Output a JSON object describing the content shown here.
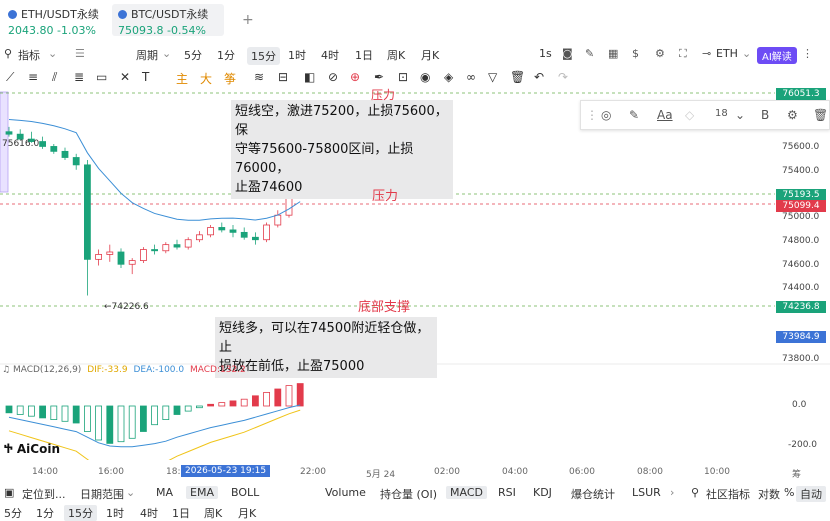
{
  "tabs": [
    {
      "symbol": "ETH/USDT永续",
      "price": "2043.80",
      "change": "-1.03%"
    },
    {
      "symbol": "BTC/USDT永续",
      "price": "75093.8",
      "change": "-0.54%"
    }
  ],
  "add_tab": "+",
  "toolbar": {
    "indicators": "指标",
    "period": "周期",
    "periods": [
      "5分",
      "1分",
      "15分",
      "1时",
      "4时",
      "1日",
      "周K",
      "月K"
    ],
    "selected_period": "15分",
    "right_label": "1s",
    "eth_label": "ETH",
    "ai_label": "AI解读"
  },
  "drawing_tools": {
    "main": "主",
    "sub": "大",
    "draw": "筝"
  },
  "notes": [
    {
      "text1": "短线空，激进75200，止损75600，保",
      "text2": "守等75600-75800区间，止损76000，",
      "text3": "止盈74600"
    },
    {
      "text1": "短线多，可以在74500附近轻仓做，止",
      "text2": "损放在前低，止盈75000"
    }
  ],
  "levels": {
    "resistance1": "压力",
    "resistance2": "压力",
    "support": "底部支撑"
  },
  "price_labels": {
    "high": "75616.0",
    "low": "74226.6"
  },
  "panel": {
    "font_size": "18"
  },
  "y_axis": [
    "76051.3",
    "75600.0",
    "75400.0",
    "75193.5",
    "75099.4",
    "75000.0",
    "74800.0",
    "74600.0",
    "74400.0",
    "74236.8",
    "73984.9",
    "73800.0",
    "0.0",
    "-200.0"
  ],
  "macd": {
    "label": "MACD(12,26,9)",
    "dif": "DIF:-33.9",
    "dea": "DEA:-100.0",
    "macd": "MACD:132.2"
  },
  "watermark": "AiCoin",
  "x_axis": [
    "14:00",
    "16:00",
    "18:",
    "2026-05-23 19:15",
    "22:00",
    "5月 24",
    "02:00",
    "04:00",
    "06:00",
    "08:00",
    "10:00",
    "筹"
  ],
  "bottom_bar": {
    "locate": "定位到...",
    "range": "日期范围",
    "indicators": [
      "MA",
      "EMA",
      "BOLL",
      "Volume",
      "持仓量 (OI)",
      "MACD",
      "RSI",
      "KDJ",
      "爆仓统计",
      "LSUR"
    ],
    "community": "社区指标",
    "log": "对数",
    "pct": "%",
    "auto": "自动"
  },
  "bottom_periods": [
    "5分",
    "1分",
    "15分",
    "1时",
    "4时",
    "1日",
    "周K",
    "月K"
  ],
  "colors": {
    "up": "#e23b4b",
    "down": "#1aa37a",
    "ema": "#3c8fd6",
    "ai": "#6d4cf5"
  },
  "chart_data": {
    "type": "candlestick",
    "candles_note": "15m BTC/USDT",
    "ohlc": [
      [
        75560,
        75600,
        75520,
        75540
      ],
      [
        75540,
        75580,
        75490,
        75500
      ],
      [
        75500,
        75560,
        75470,
        75480
      ],
      [
        75480,
        75520,
        75420,
        75440
      ],
      [
        75440,
        75460,
        75380,
        75400
      ],
      [
        75400,
        75430,
        75330,
        75350
      ],
      [
        75350,
        75380,
        75250,
        75290
      ],
      [
        75290,
        75330,
        74226,
        74520
      ],
      [
        74520,
        74600,
        74470,
        74560
      ],
      [
        74560,
        74640,
        74500,
        74580
      ],
      [
        74580,
        74610,
        74450,
        74480
      ],
      [
        74480,
        74530,
        74400,
        74510
      ],
      [
        74510,
        74620,
        74490,
        74600
      ],
      [
        74600,
        74640,
        74560,
        74590
      ],
      [
        74590,
        74660,
        74570,
        74640
      ],
      [
        74640,
        74680,
        74600,
        74620
      ],
      [
        74620,
        74700,
        74600,
        74680
      ],
      [
        74680,
        74750,
        74660,
        74720
      ],
      [
        74720,
        74800,
        74700,
        74780
      ],
      [
        74780,
        74820,
        74740,
        74760
      ],
      [
        74760,
        74800,
        74700,
        74740
      ],
      [
        74740,
        74780,
        74680,
        74700
      ],
      [
        74700,
        74740,
        74640,
        74680
      ],
      [
        74680,
        74820,
        74660,
        74800
      ],
      [
        74800,
        74920,
        74780,
        74880
      ],
      [
        74880,
        75060,
        74860,
        75040
      ],
      [
        75040,
        75160,
        75020,
        75140
      ]
    ],
    "macd_hist": [
      -40,
      -50,
      -60,
      -70,
      -80,
      -90,
      -100,
      -150,
      -200,
      -220,
      -210,
      -190,
      -150,
      -110,
      -80,
      -50,
      -30,
      -10,
      10,
      20,
      30,
      40,
      60,
      80,
      100,
      120,
      132
    ]
  }
}
